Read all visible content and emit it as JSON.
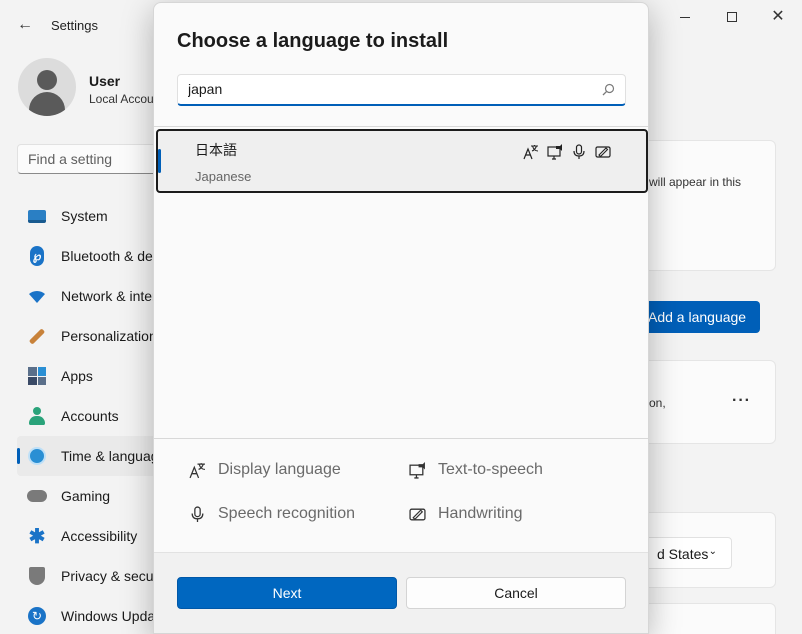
{
  "window": {
    "title": "Settings",
    "back_icon": "back-arrow-icon"
  },
  "user": {
    "name": "User",
    "subtitle": "Local Account"
  },
  "search": {
    "placeholder": "Find a setting"
  },
  "sidebar": {
    "items": [
      {
        "label": "System",
        "icon": "system-icon"
      },
      {
        "label": "Bluetooth & devices",
        "icon": "bluetooth-icon"
      },
      {
        "label": "Network & internet",
        "icon": "wifi-icon"
      },
      {
        "label": "Personalization",
        "icon": "brush-icon"
      },
      {
        "label": "Apps",
        "icon": "apps-icon"
      },
      {
        "label": "Accounts",
        "icon": "person-icon"
      },
      {
        "label": "Time & language",
        "icon": "globe-clock-icon",
        "active": true
      },
      {
        "label": "Gaming",
        "icon": "gamepad-icon"
      },
      {
        "label": "Accessibility",
        "icon": "accessibility-icon"
      },
      {
        "label": "Privacy & security",
        "icon": "shield-icon"
      },
      {
        "label": "Windows Update",
        "icon": "update-icon"
      }
    ]
  },
  "background": {
    "card_text_1": "will appear in this",
    "add_language_button": "Add a language",
    "card_text_2": "on,",
    "region_value": "d States"
  },
  "dialog": {
    "title": "Choose a language to install",
    "search_value": "japan",
    "results": [
      {
        "native_name": "日本語",
        "english_name": "Japanese",
        "features": [
          "display-language-icon",
          "text-to-speech-icon",
          "speech-recognition-icon",
          "handwriting-icon"
        ]
      }
    ],
    "legend": {
      "display_language": "Display language",
      "text_to_speech": "Text-to-speech",
      "speech_recognition": "Speech recognition",
      "handwriting": "Handwriting"
    },
    "next_label": "Next",
    "cancel_label": "Cancel"
  },
  "colors": {
    "accent": "#005fb8",
    "primary_button": "#0067c0"
  }
}
